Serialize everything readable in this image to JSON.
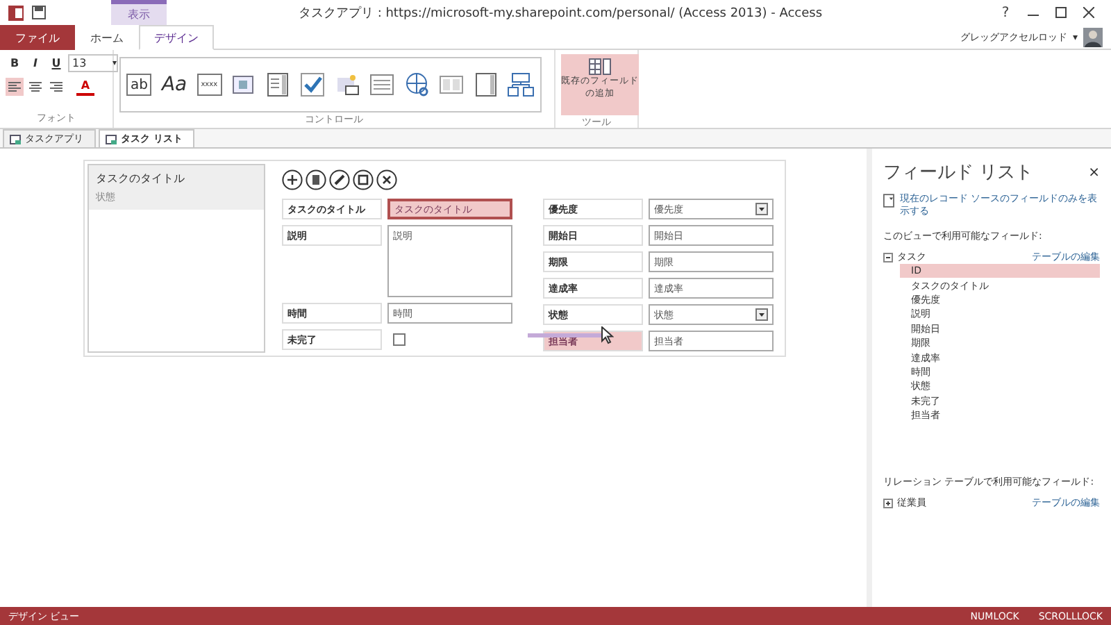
{
  "window": {
    "title": "タスクアプリ : https://microsoft-my.sharepoint.com/personal/ (Access 2013)  -  Access",
    "help": "?"
  },
  "context_tab": {
    "label": "表示"
  },
  "ribbon_tabs": [
    {
      "label": "ファイル",
      "kind": "file",
      "selected": false
    },
    {
      "label": "ホーム",
      "kind": "normal",
      "selected": false
    },
    {
      "label": "デザイン",
      "kind": "normal",
      "selected": true
    }
  ],
  "user": {
    "name": "グレッグアクセルロッド",
    "caret": "▾"
  },
  "font_group": {
    "label": "フォント",
    "styles": [
      "B",
      "I",
      "U"
    ],
    "font_size": "13",
    "size_caret": "▾",
    "align": [
      {
        "kind": "left",
        "selected": true
      },
      {
        "kind": "center",
        "selected": false
      },
      {
        "kind": "right",
        "selected": false
      }
    ],
    "color_letter": "A"
  },
  "controls_group": {
    "label": "コントロール",
    "controls": [
      {
        "kind": "textbox",
        "text": "ab"
      },
      {
        "kind": "label",
        "text": "Aa"
      },
      {
        "kind": "button",
        "text": "xxxx"
      },
      {
        "kind": "web"
      },
      {
        "kind": "combo"
      },
      {
        "kind": "check"
      },
      {
        "kind": "image"
      },
      {
        "kind": "list"
      },
      {
        "kind": "hyperlink"
      },
      {
        "kind": "multi"
      },
      {
        "kind": "listbox"
      },
      {
        "kind": "related"
      }
    ]
  },
  "tools_group": {
    "label": "ツール",
    "button": {
      "lines": [
        "既存のフィールド",
        "の追加"
      ],
      "selected": true
    }
  },
  "doc_tabs": [
    {
      "label": "タスクアプリ",
      "selected": false
    },
    {
      "label": "タスク リスト",
      "selected": true
    }
  ],
  "form": {
    "list_items": [
      {
        "text": "タスクのタイトル",
        "kind": "title"
      },
      {
        "text": "状態",
        "kind": "sub"
      }
    ],
    "actions": [
      {
        "kind": "add"
      },
      {
        "kind": "delete"
      },
      {
        "kind": "edit"
      },
      {
        "kind": "save"
      },
      {
        "kind": "cancel"
      }
    ],
    "left_fields": [
      {
        "label": "タスクのタイトル",
        "value": "タスクのタイトル",
        "kind": "text",
        "selected": true,
        "label_selected": false
      },
      {
        "label": "説明",
        "value": "説明",
        "kind": "memo",
        "selected": false,
        "label_selected": false
      },
      {
        "label": "時間",
        "value": "時間",
        "kind": "text",
        "selected": false,
        "label_selected": false
      },
      {
        "label": "未完了",
        "kind": "checkbox",
        "checked": false,
        "label_selected": false
      }
    ],
    "right_fields": [
      {
        "label": "優先度",
        "value": "優先度",
        "kind": "dropdown",
        "selected": false,
        "label_selected": false
      },
      {
        "label": "開始日",
        "value": "開始日",
        "kind": "text",
        "selected": false,
        "label_selected": false
      },
      {
        "label": "期限",
        "value": "期限",
        "kind": "text",
        "selected": false,
        "label_selected": false
      },
      {
        "label": "達成率",
        "value": "達成率",
        "kind": "text",
        "selected": false,
        "label_selected": false
      },
      {
        "label": "状態",
        "value": "状態",
        "kind": "dropdown",
        "selected": false,
        "label_selected": false
      },
      {
        "label": "担当者",
        "value": "担当者",
        "kind": "text",
        "selected": false,
        "label_selected": true
      }
    ]
  },
  "field_list": {
    "title": "フィールド リスト",
    "close": "×",
    "option": "現在のレコード ソースのフィールドのみを表示する",
    "available_label": "このビューで利用可能なフィールド:",
    "table": {
      "name": "タスク",
      "expanded": true,
      "edit_link": "テーブルの編集",
      "fields": [
        {
          "name": "ID",
          "selected": true
        },
        {
          "name": "タスクのタイトル",
          "selected": false
        },
        {
          "name": "優先度",
          "selected": false
        },
        {
          "name": "説明",
          "selected": false
        },
        {
          "name": "開始日",
          "selected": false
        },
        {
          "name": "期限",
          "selected": false
        },
        {
          "name": "達成率",
          "selected": false
        },
        {
          "name": "時間",
          "selected": false
        },
        {
          "name": "状態",
          "selected": false
        },
        {
          "name": "未完了",
          "selected": false
        },
        {
          "name": "担当者",
          "selected": false
        }
      ]
    },
    "related_label": "リレーション テーブルで利用可能なフィールド:",
    "related_table": {
      "name": "従業員",
      "expanded": false,
      "edit_link": "テーブルの編集"
    }
  },
  "status_bar": {
    "left": "デザイン ビュー",
    "indicators": [
      "NUMLOCK",
      "SCROLLLOCK"
    ]
  }
}
